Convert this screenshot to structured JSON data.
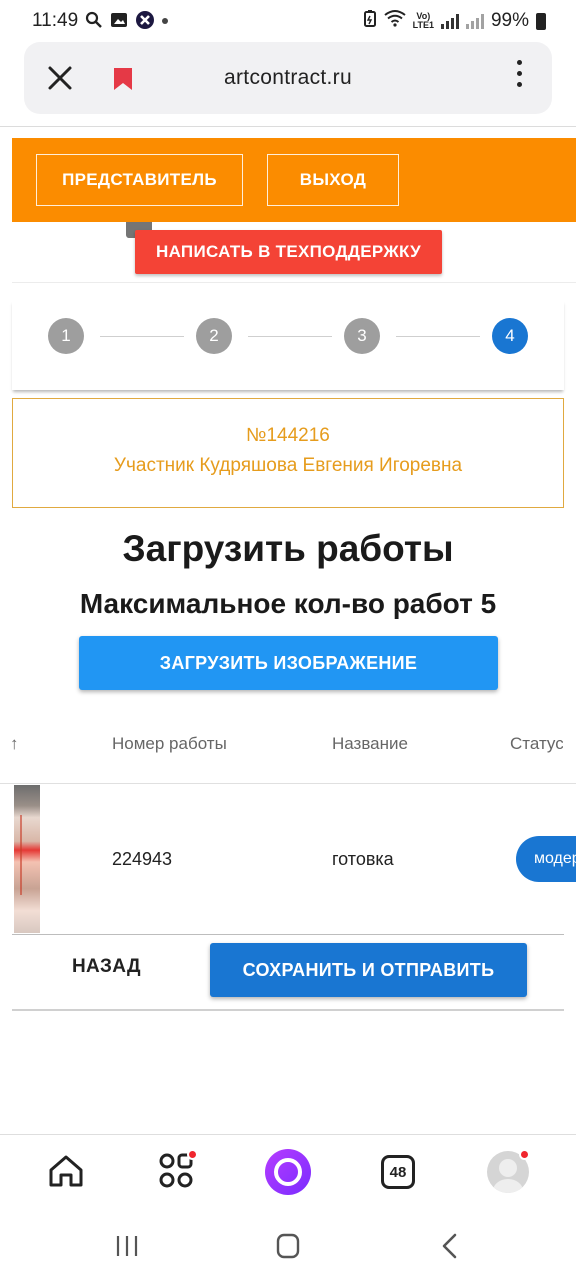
{
  "status_bar": {
    "time": "11:49",
    "battery": "99%"
  },
  "browser": {
    "url": "artcontract.ru",
    "tab_count": "48"
  },
  "header": {
    "representative_button": "ПРЕДСТАВИТЕЛЬ",
    "exit_button": "ВЫХОД"
  },
  "support_button": "НАПИСАТЬ В ТЕХПОДДЕРЖКУ",
  "stepper": {
    "steps": [
      "1",
      "2",
      "3",
      "4"
    ],
    "active_step": 4
  },
  "participant": {
    "number": "№144216",
    "name": "Участник Кудряшова Евгения Игоревна"
  },
  "page": {
    "title": "Загрузить работы",
    "subtitle": "Максимальное кол-во работ 5",
    "upload_button": "ЗАГРУЗИТЬ ИЗОБРАЖЕНИЕ"
  },
  "table": {
    "columns": {
      "sort": "↑",
      "number": "Номер работы",
      "name": "Название",
      "status": "Статус"
    },
    "rows": [
      {
        "number": "224943",
        "name": "готовка",
        "status": "модерация"
      }
    ]
  },
  "actions": {
    "back": "НАЗАД",
    "save": "СОХРАНИТЬ И ОТПРАВИТЬ"
  },
  "colors": {
    "header_orange": "#fb8c00",
    "support_red": "#f44336",
    "primary_blue": "#1976d2",
    "upload_blue": "#2196f3",
    "participant_gold": "#e69c1d"
  }
}
